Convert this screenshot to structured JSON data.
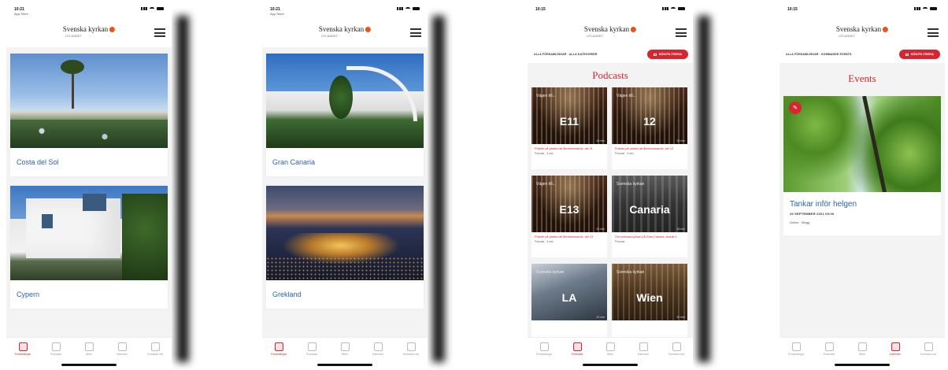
{
  "status": {
    "time": "10:21",
    "back": "App Store",
    "time_2": "10:15"
  },
  "brand": {
    "name": "Svenska kyrkan",
    "sub": "UTLANDET",
    "accent": "#e8531e",
    "red": "#d7262f",
    "link": "#2b63a6"
  },
  "screens": [
    {
      "cards": [
        {
          "label": "Costa del Sol"
        },
        {
          "label": "Cypern"
        }
      ],
      "active_tab": 0
    },
    {
      "cards": [
        {
          "label": "Gran Canaria"
        },
        {
          "label": "Grekland"
        }
      ],
      "active_tab": 0
    },
    {
      "filter": {
        "crumbs": "ALLA FÖRSAMLINGAR · ALLA KATEGORIER",
        "button": "SÖK/FILTRERA"
      },
      "title": "Podcasts",
      "podcasts": [
        {
          "overlay": "Vägen till...",
          "big": "E11",
          "title": "Präster på platser att återkommande, del 11",
          "meta": "Podcast · 3 min",
          "duration": "24 min"
        },
        {
          "overlay": "Vägen till...",
          "big": "12",
          "title": "Präster på platser att återkommande, del 12",
          "meta": "Podcast · 3 min",
          "duration": "26 min"
        },
        {
          "overlay": "Vägen till...",
          "big": "E13",
          "title": "Präster på platser att återkommande, del 13",
          "meta": "Podcast · 3 min",
          "duration": "31 min"
        },
        {
          "overlay": "Svenska kyrkan",
          "big": "Canaria",
          "title": "Om svenska kyrkan på Gran Canaria, avsnitt 1",
          "meta": "Podcast",
          "duration": "18 min"
        },
        {
          "overlay": "Svenska kyrkan",
          "big": "LA",
          "title": "",
          "meta": "",
          "duration": "22 min"
        },
        {
          "overlay": "Svenska kyrkan",
          "big": "Wien",
          "title": "",
          "meta": "",
          "duration": "20 min"
        }
      ],
      "active_tab": 1
    },
    {
      "filter": {
        "crumbs": "ALLA FÖRSAMLINGAR · KOMMANDE EVENTS",
        "button": "SÖK/FILTRERA"
      },
      "title": "Events",
      "event": {
        "title": "Tankar inför helgen",
        "date": "25 SEPTEMBER 2021 09:00",
        "location": "Online · Blogg"
      },
      "active_tab": 3
    }
  ],
  "tabs": [
    {
      "label": "Församlingar",
      "icon": "pin-icon"
    },
    {
      "label": "Podcasts",
      "icon": "mic-icon"
    },
    {
      "label": "Bibel",
      "icon": "book-icon"
    },
    {
      "label": "Kalender",
      "icon": "calendar-icon"
    },
    {
      "label": "Kontakta oss",
      "icon": "people-icon"
    }
  ]
}
